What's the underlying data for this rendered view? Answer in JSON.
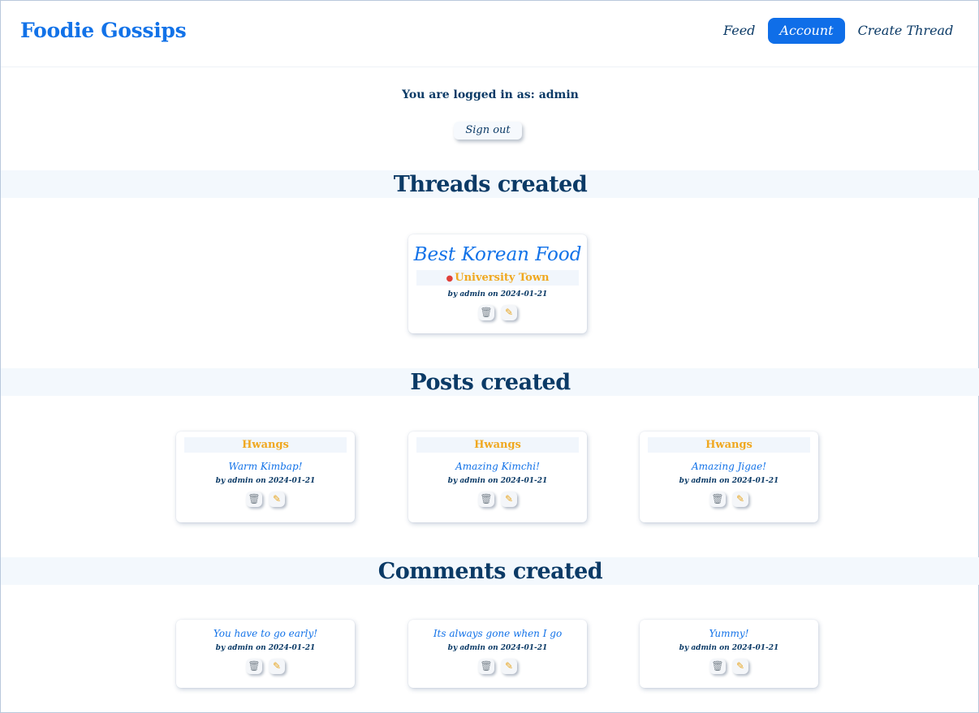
{
  "header": {
    "brand": "Foodie Gossips",
    "nav": [
      {
        "label": "Feed",
        "active": false
      },
      {
        "label": "Account",
        "active": true
      },
      {
        "label": "Create Thread",
        "active": false
      }
    ]
  },
  "account": {
    "logged_in_text": "You are logged in as: admin",
    "sign_out_label": "Sign out"
  },
  "sections": {
    "threads_title": "Threads created",
    "posts_title": "Posts created",
    "comments_title": "Comments created"
  },
  "threads": [
    {
      "title": "Best Korean Food",
      "location": "University Town",
      "meta": "by admin on 2024-01-21"
    }
  ],
  "posts": [
    {
      "thread": "Hwangs",
      "title": "Warm Kimbap!",
      "meta": "by admin on 2024-01-21"
    },
    {
      "thread": "Hwangs",
      "title": "Amazing Kimchi!",
      "meta": "by admin on 2024-01-21"
    },
    {
      "thread": "Hwangs",
      "title": "Amazing Jigae!",
      "meta": "by admin on 2024-01-21"
    }
  ],
  "comments": [
    {
      "text": "You have to go early!",
      "meta": "by admin on 2024-01-21"
    },
    {
      "text": "Its always gone when I go",
      "meta": "by admin on 2024-01-21"
    },
    {
      "text": "Yummy!",
      "meta": "by admin on 2024-01-21"
    }
  ],
  "icons": {
    "trash": "trash-icon",
    "pencil": "pencil-icon",
    "pin": "pin-icon"
  },
  "colors": {
    "brand": "#1272e8",
    "nav_active_bg": "#0f6ee8",
    "heading": "#0b3a66",
    "tag": "#f0a820",
    "section_band": "#f3f8fd"
  }
}
